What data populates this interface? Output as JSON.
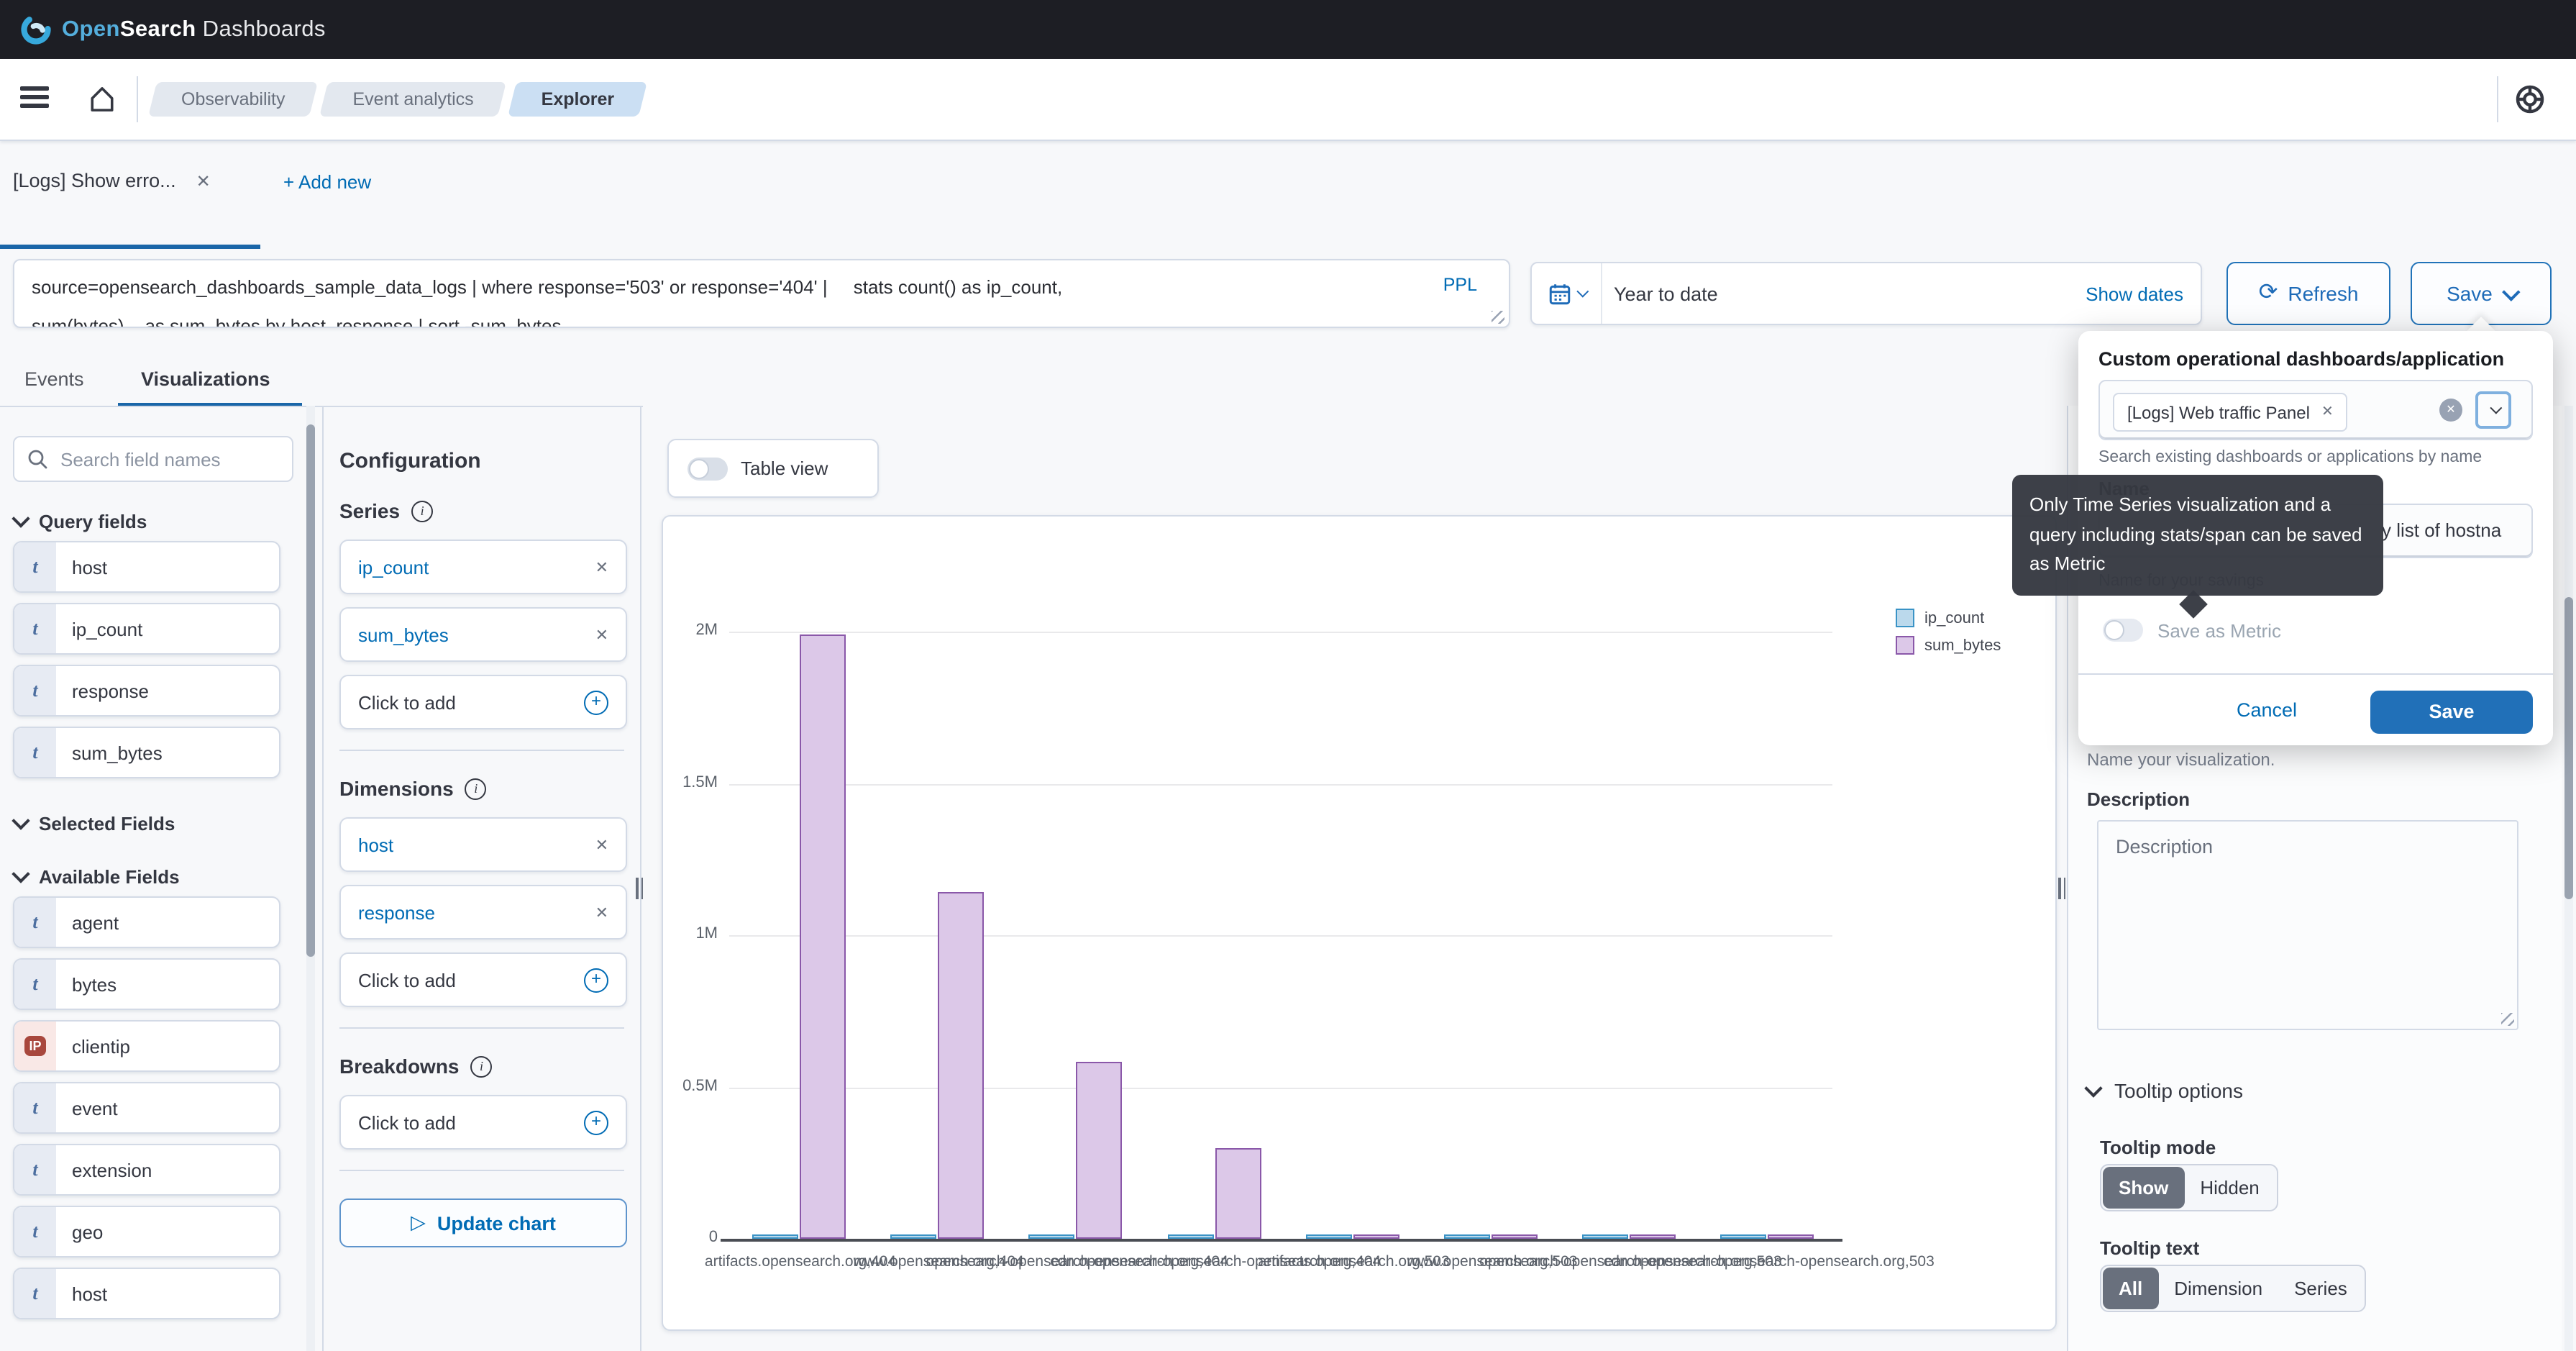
{
  "navbar": {
    "logo_open": "Open",
    "logo_search": "Search",
    "logo_rest": " Dashboards"
  },
  "breadcrumbs": {
    "items": [
      {
        "label": "Observability",
        "active": false
      },
      {
        "label": "Event analytics",
        "active": false
      },
      {
        "label": "Explorer",
        "active": true
      }
    ]
  },
  "tabbar": {
    "tab_title": "[Logs] Show erro...",
    "close_glyph": "✕",
    "add_new": "+ Add new"
  },
  "query": {
    "line1": "source=opensearch_dashboards_sample_data_logs | where response='503' or response='404' |     stats count() as ip_count,",
    "line2": "sum(bytes)    as sum_bytes by host, response | sort -sum_bytes",
    "lang": "PPL"
  },
  "timebar": {
    "range": "Year to date",
    "show_dates": "Show dates",
    "refresh": "Refresh",
    "save": "Save",
    "refresh_glyph": "⟳"
  },
  "explorer_tabs": {
    "events": "Events",
    "visualizations": "Visualizations"
  },
  "sidebar": {
    "search_placeholder": "Search field names",
    "sections": {
      "query_fields": "Query fields",
      "selected_fields": "Selected Fields",
      "available_fields": "Available Fields"
    },
    "query_fields": [
      {
        "type": "t",
        "name": "host"
      },
      {
        "type": "t",
        "name": "ip_count"
      },
      {
        "type": "t",
        "name": "response"
      },
      {
        "type": "t",
        "name": "sum_bytes"
      }
    ],
    "available_fields": [
      {
        "type": "t",
        "name": "agent"
      },
      {
        "type": "t",
        "name": "bytes"
      },
      {
        "type": "ip",
        "name": "clientip"
      },
      {
        "type": "t",
        "name": "event"
      },
      {
        "type": "t",
        "name": "extension"
      },
      {
        "type": "t",
        "name": "geo"
      },
      {
        "type": "t",
        "name": "host"
      }
    ]
  },
  "config": {
    "title": "Configuration",
    "add_label": "Click to add",
    "remove_glyph": "✕",
    "plus_glyph": "+",
    "sections": [
      {
        "label": "Series",
        "items": [
          "ip_count",
          "sum_bytes"
        ]
      },
      {
        "label": "Dimensions",
        "items": [
          "host",
          "response"
        ]
      },
      {
        "label": "Breakdowns",
        "items": []
      }
    ],
    "update_button": "Update chart",
    "play_glyph": "▷"
  },
  "chart_panel": {
    "table_view": "Table view"
  },
  "chart_data": {
    "type": "bar",
    "title": "",
    "xlabel": "",
    "ylabel": "",
    "categories": [
      "artifacts.opensearch.org,404",
      "www.opensearch.org,404",
      "opensearch-opensearch-opensearch.org,404",
      "cdn.opensearch-opensearch-opensearch.org,404",
      "artifacts.opensearch.org,503",
      "www.opensearch.org,503",
      "opensearch-opensearch-opensearch.org,503",
      "cdn.opensearch-opensearch-opensearch.org,503"
    ],
    "series": [
      {
        "name": "ip_count",
        "fill": "#BBD9EC",
        "border": "#3A93C6",
        "values": [
          345,
          205,
          118,
          62,
          8,
          5,
          3,
          2
        ]
      },
      {
        "name": "sum_bytes",
        "fill": "#DCC8E8",
        "border": "#8A58A9",
        "values": [
          1990000,
          1140000,
          585000,
          300000,
          9500,
          7000,
          5000,
          4000
        ]
      }
    ],
    "ylim": [
      0,
      2000000
    ],
    "yticks": [
      {
        "value": 0,
        "label": "0"
      },
      {
        "value": 500000,
        "label": "0.5M"
      },
      {
        "value": 1000000,
        "label": "1M"
      },
      {
        "value": 1500000,
        "label": "1.5M"
      },
      {
        "value": 2000000,
        "label": "2M"
      }
    ],
    "grid": true,
    "legend_position": "top-right"
  },
  "right_panel": {
    "name_helper": "Name your visualization.",
    "description_label": "Description",
    "description_placeholder": "Description",
    "tooltip_options": "Tooltip options",
    "tooltip_mode_label": "Tooltip mode",
    "tooltip_mode": [
      {
        "label": "Show",
        "selected": true
      },
      {
        "label": "Hidden",
        "selected": false
      }
    ],
    "tooltip_text_label": "Tooltip text",
    "tooltip_text": [
      {
        "label": "All",
        "selected": true
      },
      {
        "label": "Dimension",
        "selected": false
      },
      {
        "label": "Series",
        "selected": false
      }
    ]
  },
  "save_popover": {
    "title": "Custom operational dashboards/application",
    "selected_panel": "[Logs] Web traffic Panel",
    "remove_glyph": "✕",
    "clear_glyph": "✕",
    "helper": "Search existing dashboards or applications by name",
    "name_label": "Name",
    "name_value_visible": "y list of hostna",
    "name_helper": "Name for your savings",
    "metric_toggle_label": "Save as Metric",
    "cancel": "Cancel",
    "save": "Save",
    "tooltip": "Only Time Series visualization and a query including stats/span can be saved as Metric"
  },
  "colors": {
    "accent": "#006BB4",
    "navbar_bg": "#1D1E24",
    "selected_segment": "#69707D",
    "tooltip_bg": "#353841",
    "bar_blue_fill": "#BBD9EC",
    "bar_blue_border": "#3A93C6",
    "bar_purple_fill": "#DCC8E8",
    "bar_purple_border": "#8A58A9"
  }
}
